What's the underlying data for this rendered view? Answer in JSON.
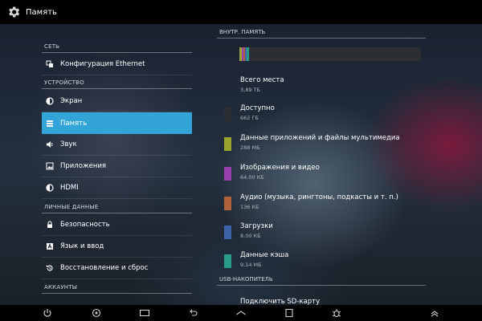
{
  "app": {
    "title": "Память"
  },
  "sidebar": {
    "sections": [
      {
        "header": "СЕТЬ",
        "items": [
          {
            "label": "Конфигурация Ethernet",
            "icon": "ethernet-icon"
          }
        ]
      },
      {
        "header": "УСТРОЙСТВО",
        "items": [
          {
            "label": "Экран",
            "icon": "brightness-icon"
          },
          {
            "label": "Память",
            "icon": "storage-icon",
            "selected": true
          },
          {
            "label": "Звук",
            "icon": "speaker-icon"
          },
          {
            "label": "Приложения",
            "icon": "apps-icon"
          },
          {
            "label": "HDMI",
            "icon": "hdmi-icon"
          }
        ]
      },
      {
        "header": "ЛИЧНЫЕ ДАННЫЕ",
        "items": [
          {
            "label": "Безопасность",
            "icon": "lock-icon"
          },
          {
            "label": "Язык и ввод",
            "icon": "language-icon"
          },
          {
            "label": "Восстановление и сброс",
            "icon": "restore-icon"
          }
        ]
      },
      {
        "header": "АККАУНТЫ",
        "items": []
      }
    ],
    "selected_color": "#33a4d8"
  },
  "storage": {
    "internal_header": "ВНУТР. ПАМЯТЬ",
    "total": {
      "name": "Всего места",
      "value": "3,89 ТБ"
    },
    "categories": [
      {
        "name": "Доступно",
        "value": "662 ГБ",
        "color": "#2b2f33"
      },
      {
        "name": "Данные приложений и файлы мультимедиа",
        "value": "288 МБ",
        "color": "#9aa52e"
      },
      {
        "name": "Изображения и видео",
        "value": "64,00 КБ",
        "color": "#9a3fb0"
      },
      {
        "name": "Аудио (музыка, рингтоны, подкасты и т. п.)",
        "value": "136 КБ",
        "color": "#b0623a"
      },
      {
        "name": "Загрузки",
        "value": "8,00 КБ",
        "color": "#3b63a8"
      },
      {
        "name": "Данные кэша",
        "value": "9,14 МБ",
        "color": "#2a9a8a"
      }
    ],
    "usb_header": "USB-НАКОПИТЕЛЬ",
    "usb_link": "Подключить SD-карту"
  },
  "navbar": {
    "icons": [
      "power-icon",
      "settings-icon",
      "recent-apps-icon",
      "back-icon",
      "home-icon",
      "screenshot-icon",
      "bug-icon",
      "up-icon"
    ]
  }
}
